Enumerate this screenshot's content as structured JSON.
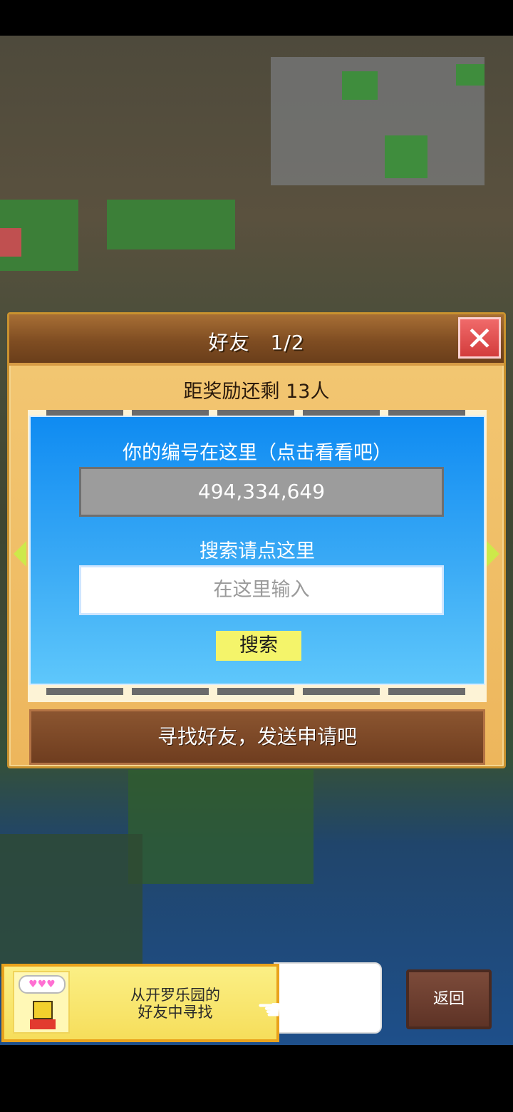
{
  "dialog": {
    "title": "好友　1/2",
    "close_icon": "close-x-icon",
    "reward_text": "距奖励还剩 13人",
    "id_label": "你的编号在这里（点击看看吧）",
    "id_value": "494,334,649",
    "search_label": "搜索请点这里",
    "search_placeholder": "在这里输入",
    "search_button": "搜索",
    "find_button": "寻找好友，发送申请吧",
    "prev_icon": "arrow-left-icon",
    "next_icon": "arrow-right-icon"
  },
  "bottom": {
    "kairo_line1": "从开罗乐园的",
    "kairo_line2": "好友中寻找",
    "avatar_bubble": "♥♥♥",
    "back_label": "返回"
  }
}
